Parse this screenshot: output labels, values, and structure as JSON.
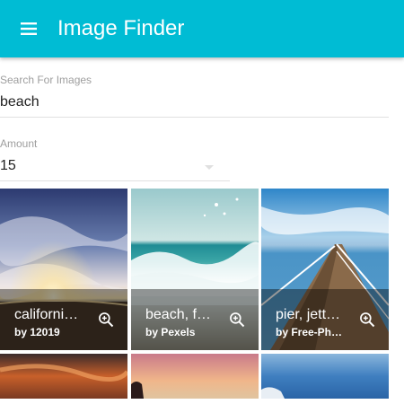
{
  "app": {
    "title": "Image Finder",
    "menu_icon": "menu-icon",
    "accent_color": "#00bcd4"
  },
  "search": {
    "label": "Search For Images",
    "value": "beach"
  },
  "amount": {
    "label": "Amount",
    "value": "15"
  },
  "results": [
    {
      "title": "californi…",
      "byline": "by 12019",
      "icon": "zoom-in-icon"
    },
    {
      "title": "beach, f…",
      "byline": "by Pexels",
      "icon": "zoom-in-icon"
    },
    {
      "title": "pier, jett…",
      "byline": "by Free-Ph…",
      "icon": "zoom-in-icon"
    }
  ]
}
